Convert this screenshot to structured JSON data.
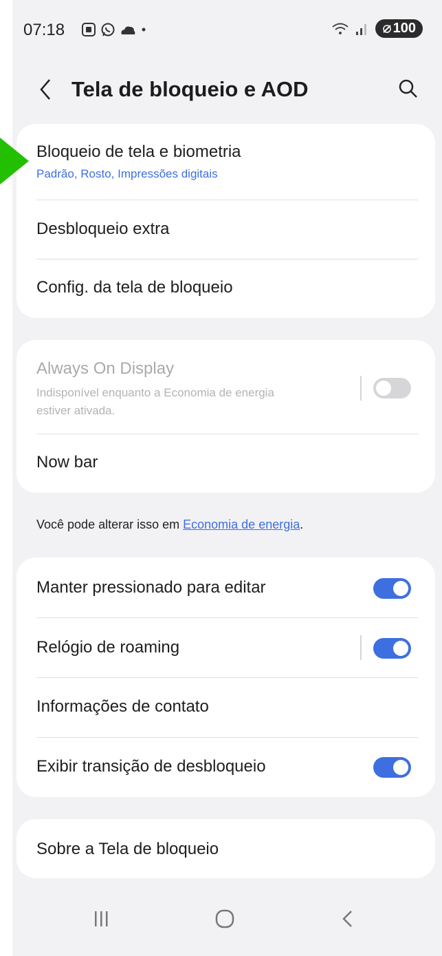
{
  "status_bar": {
    "time": "07:18",
    "battery": "100",
    "notification_icons": [
      "screenshot-icon",
      "whatsapp-icon",
      "cloud-icon",
      "dot-icon"
    ]
  },
  "header": {
    "title": "Tela de bloqueio e AOD"
  },
  "card1": {
    "item1_label": "Bloqueio de tela e biometria",
    "item1_sub": "Padrão, Rosto, Impressões digitais",
    "item2_label": "Desbloqueio extra",
    "item3_label": "Config. da tela de bloqueio"
  },
  "card2": {
    "aod_label": "Always On Display",
    "aod_sub_line1": "Indisponível enquanto a Economia de energia",
    "aod_sub_line2": "estiver ativada.",
    "aod_enabled": false,
    "nowbar_label": "Now bar"
  },
  "note": {
    "prefix": "Você pode alterar isso em ",
    "link": "Economia de energia",
    "suffix": "."
  },
  "card3": {
    "item1_label": "Manter pressionado para editar",
    "item1_on": true,
    "item2_label": "Relógio de roaming",
    "item2_on": true,
    "item3_label": "Informações de contato",
    "item4_label": "Exibir transição de desbloqueio",
    "item4_on": true
  },
  "card4": {
    "item1_label": "Sobre a Tela de bloqueio"
  },
  "colors": {
    "accent": "#3e6fe0",
    "background": "#f2f2f5",
    "pointer": "#22c000"
  }
}
